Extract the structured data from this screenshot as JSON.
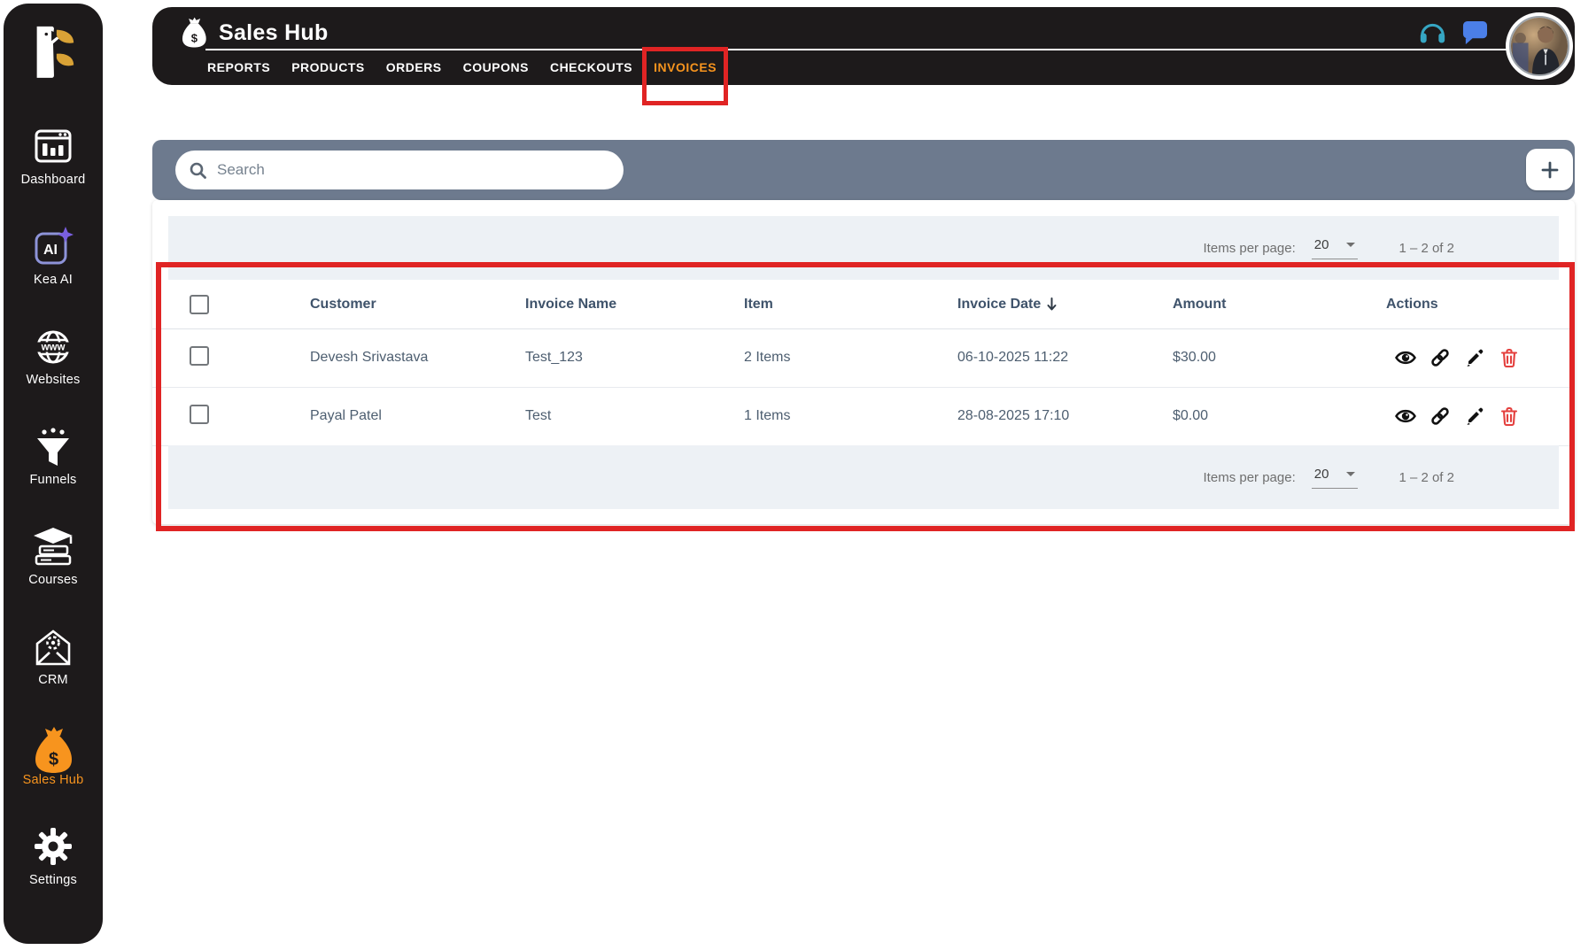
{
  "app_title": "Sales Hub",
  "sidebar": {
    "items": [
      {
        "label": "Dashboard",
        "icon": "dashboard-icon",
        "active": false
      },
      {
        "label": "Kea AI",
        "icon": "kea-ai-icon",
        "active": false
      },
      {
        "label": "Websites",
        "icon": "globe-www-icon",
        "active": false
      },
      {
        "label": "Funnels",
        "icon": "funnel-icon",
        "active": false
      },
      {
        "label": "Courses",
        "icon": "courses-icon",
        "active": false
      },
      {
        "label": "CRM",
        "icon": "crm-envelope-gear-icon",
        "active": false
      },
      {
        "label": "Sales Hub",
        "icon": "money-bag-icon",
        "active": true
      },
      {
        "label": "Settings",
        "icon": "gear-icon",
        "active": false
      }
    ]
  },
  "header": {
    "title": "Sales Hub",
    "title_icon": "money-bag-icon",
    "tabs": [
      {
        "label": "REPORTS",
        "active": false
      },
      {
        "label": "PRODUCTS",
        "active": false
      },
      {
        "label": "ORDERS",
        "active": false
      },
      {
        "label": "COUPONS",
        "active": false
      },
      {
        "label": "CHECKOUTS",
        "active": false
      },
      {
        "label": "INVOICES",
        "active": true,
        "annotated": true
      }
    ],
    "right_icons": [
      "headset-icon",
      "chat-icon",
      "user-avatar"
    ]
  },
  "toolbar": {
    "search_placeholder": "Search",
    "search_value": "",
    "add_button_icon": "plus-icon"
  },
  "paginator": {
    "items_per_page_label": "Items per page:",
    "page_size": "20",
    "range_label": "1 – 2 of 2"
  },
  "table": {
    "columns": [
      {
        "label": "Customer"
      },
      {
        "label": "Invoice Name"
      },
      {
        "label": "Item"
      },
      {
        "label": "Invoice Date",
        "sorted": "desc"
      },
      {
        "label": "Amount"
      },
      {
        "label": "Actions"
      }
    ],
    "row_actions": [
      "view",
      "copy-link",
      "edit",
      "delete"
    ],
    "rows": [
      {
        "customer": "Devesh Srivastava",
        "invoice_name": "Test_123",
        "item": "2 Items",
        "invoice_date": "06-10-2025 11:22",
        "amount": "$30.00"
      },
      {
        "customer": "Payal Patel",
        "invoice_name": "Test",
        "item": "1 Items",
        "invoice_date": "28-08-2025 17:10",
        "amount": "$0.00"
      }
    ]
  },
  "annotations": [
    {
      "target": "invoices-tab",
      "shape": "red-box"
    },
    {
      "target": "invoice-table",
      "shape": "red-box"
    }
  ],
  "colors": {
    "accent": "#f7941e",
    "dark_bg": "#1d1a1b",
    "toolbar_bg": "#6d7a8e",
    "band_bg": "#edf1f5",
    "annotation_red": "#e02424",
    "delete_red": "#e4403e",
    "chat_blue": "#4b7fe8",
    "headset_teal": "#36a6c3"
  }
}
